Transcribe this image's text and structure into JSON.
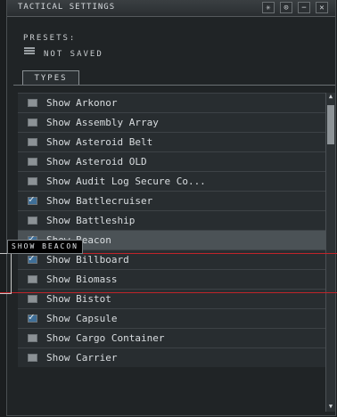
{
  "window": {
    "title": "TACTICAL SETTINGS",
    "buttons": [
      {
        "name": "settings-button",
        "icon": "✳"
      },
      {
        "name": "info-button",
        "icon": "⊙"
      },
      {
        "name": "minimize-button",
        "icon": "−"
      },
      {
        "name": "close-button",
        "icon": "✕"
      }
    ]
  },
  "presets": {
    "label": "PRESETS:",
    "value": "NOT SAVED"
  },
  "tabs": [
    {
      "label": "TYPES"
    }
  ],
  "list": {
    "items": [
      {
        "label": "Show Arkonor",
        "checked": false
      },
      {
        "label": "Show Assembly Array",
        "checked": false
      },
      {
        "label": "Show Asteroid Belt",
        "checked": false
      },
      {
        "label": "Show Asteroid OLD",
        "checked": false
      },
      {
        "label": "Show Audit Log Secure Co...",
        "checked": false
      },
      {
        "label": "Show Battlecruiser",
        "checked": true
      },
      {
        "label": "Show Battleship",
        "checked": false
      },
      {
        "label": "Show Beacon",
        "checked": true,
        "selected": true
      },
      {
        "label": "Show Billboard",
        "checked": true
      },
      {
        "label": "Show Biomass",
        "checked": false
      },
      {
        "label": "Show Bistot",
        "checked": false
      },
      {
        "label": "Show Capsule",
        "checked": true
      },
      {
        "label": "Show Cargo Container",
        "checked": false
      },
      {
        "label": "Show Carrier",
        "checked": false
      }
    ]
  },
  "tooltip": {
    "text": "SHOW BEACON"
  },
  "colors": {
    "accent_check": "#3f6f98",
    "highlight_line": "#c0242a"
  }
}
